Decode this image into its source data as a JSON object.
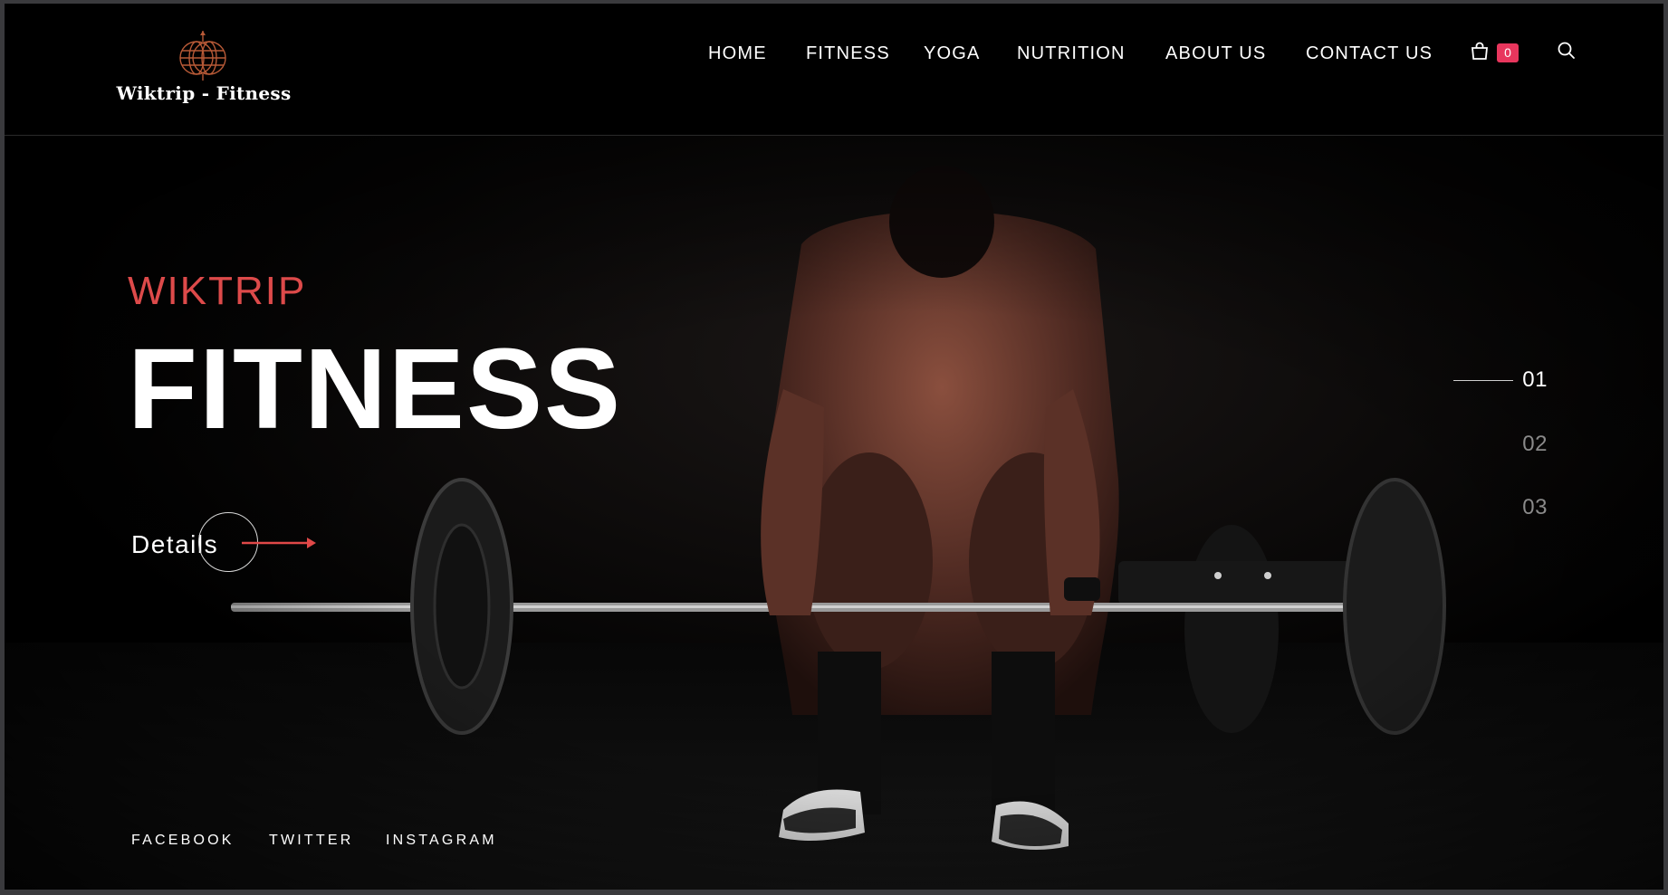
{
  "brand": {
    "logo_text": "Wiktrip - Fitness",
    "logo_icon": "globe-icon"
  },
  "nav": {
    "items": [
      {
        "label": "HOME"
      },
      {
        "label": "FITNESS"
      },
      {
        "label": "YOGA"
      },
      {
        "label": "NUTRITION"
      },
      {
        "label": "ABOUT US"
      },
      {
        "label": "CONTACT US"
      }
    ],
    "cart_count": "0",
    "cart_icon": "shopping-bag-icon",
    "search_icon": "search-icon"
  },
  "hero": {
    "eyebrow": "WIKTRIP",
    "headline": "FITNESS",
    "cta_label": "Details",
    "slides": [
      "01",
      "02",
      "03"
    ],
    "active_slide": "01"
  },
  "social": {
    "links": [
      "FACEBOOK",
      "TWITTER",
      "INSTAGRAM"
    ]
  },
  "colors": {
    "accent": "#dd4a4a",
    "badge": "#e8365d",
    "background": "#000000",
    "text": "#ffffff",
    "muted": "#8a8a8a"
  }
}
